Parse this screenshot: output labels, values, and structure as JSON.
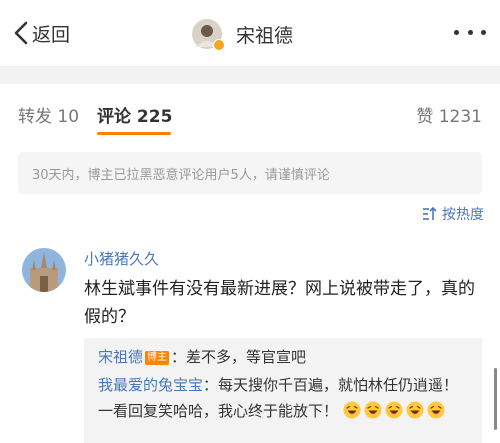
{
  "header": {
    "back_label": "返回",
    "user_name": "宋祖德",
    "icons": {
      "back": "chevron-left-icon",
      "more": "more-horizontal-icon",
      "verified": "verified-badge-icon"
    }
  },
  "tabs": {
    "repost": "转发 10",
    "comment": "评论 225",
    "like": "赞 1231",
    "active": "comment"
  },
  "notice": "30天内，博主已拉黑恶意评论用户5人，请谨慎评论",
  "sort": {
    "label": "按热度",
    "icon": "sort-icon"
  },
  "comment": {
    "user": "小猪猪久久",
    "text": "林生斌事件有没有最新进展？网上说被带走了，真的假的？",
    "replies": [
      {
        "user": "宋祖德",
        "badge": "博主",
        "text": "：差不多，等官宣吧"
      },
      {
        "user": "我最爱的兔宝宝",
        "text": "：每天搜你千百遍，就怕林任仍逍遥！一看回复笑哈哈，我心终于能放下！",
        "emoji": "laughing-emoji-icon",
        "emoji_count": 5
      }
    ]
  },
  "colors": {
    "accent": "#ff8200",
    "link": "#4a78b8",
    "background_gap": "#f2f2f2"
  }
}
